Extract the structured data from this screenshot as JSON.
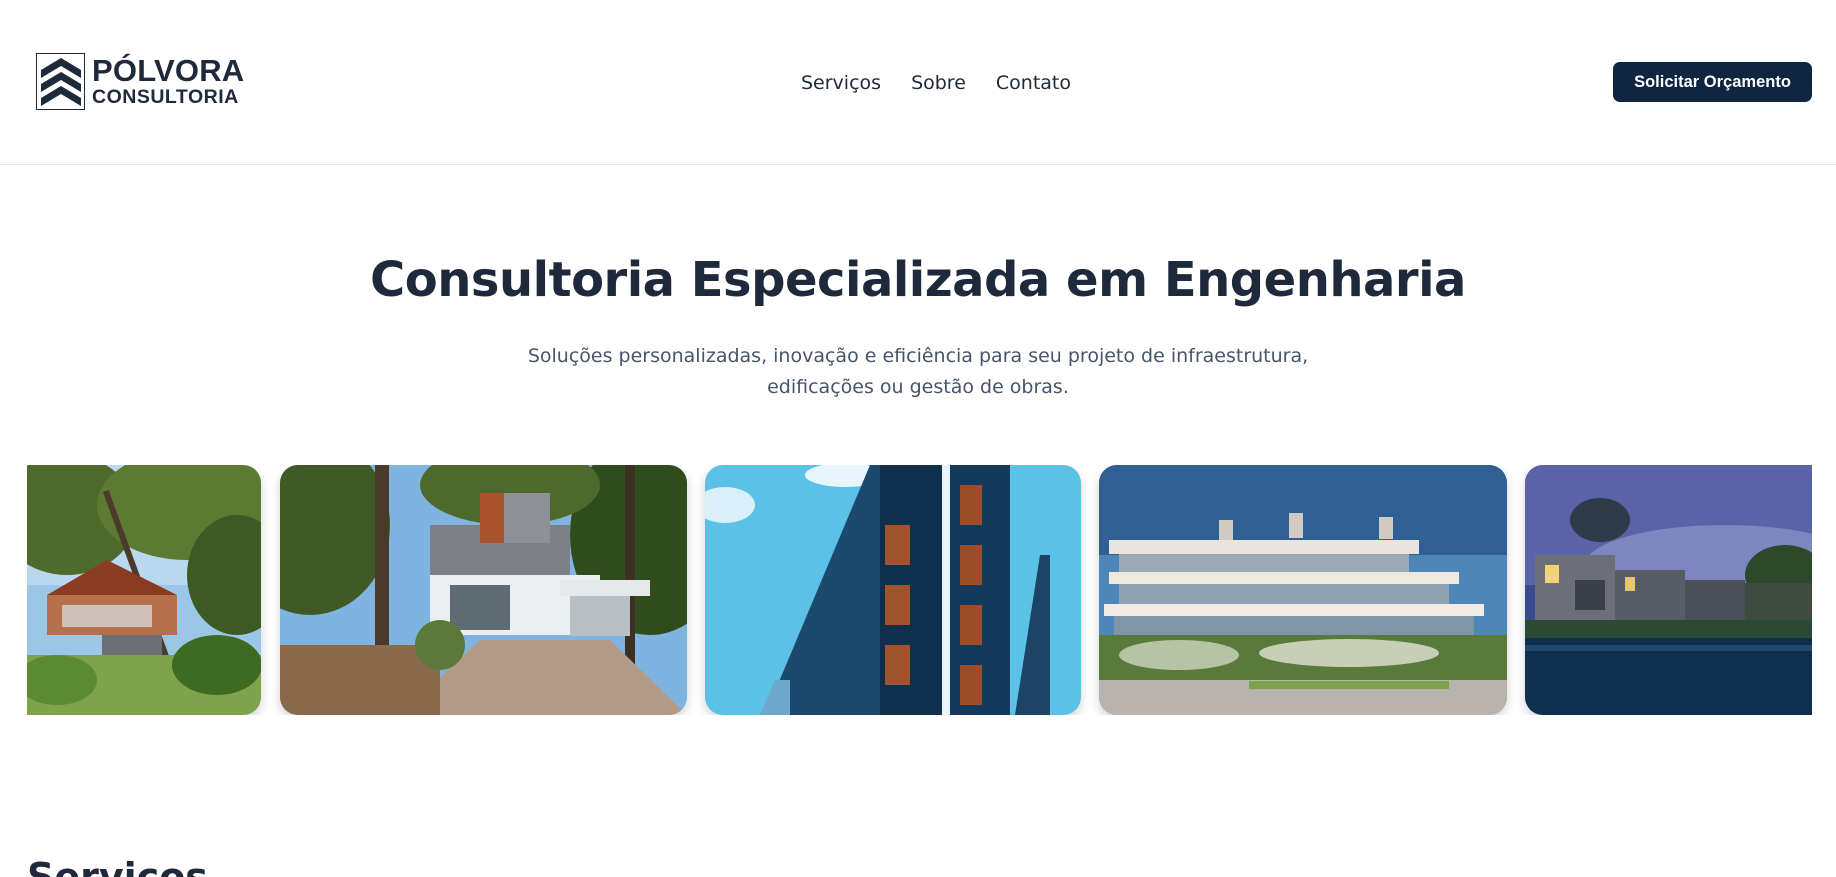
{
  "brand": {
    "line1": "PÓLVORA",
    "line2": "CONSULTORIA",
    "icon": "chevron-stack-logo-icon",
    "color": "#1e293b"
  },
  "nav": {
    "items": [
      {
        "label": "Serviços"
      },
      {
        "label": "Sobre"
      },
      {
        "label": "Contato"
      }
    ]
  },
  "header": {
    "cta_label": "Solicitar Orçamento",
    "cta_color": "#0f2540"
  },
  "hero": {
    "title": "Consultoria Especializada em Engenharia",
    "subtitle": "Soluções personalizadas, inovação e eficiência para seu projeto de infraestrutura, edificações ou gestão de obras."
  },
  "gallery": {
    "images": [
      {
        "name": "forest-house-photo"
      },
      {
        "name": "modern-house-forest-photo"
      },
      {
        "name": "blue-facade-building-photo"
      },
      {
        "name": "terraced-residential-building-photo"
      },
      {
        "name": "lakeside-houses-dusk-photo"
      }
    ]
  },
  "next_section": {
    "title": "Serviços"
  }
}
